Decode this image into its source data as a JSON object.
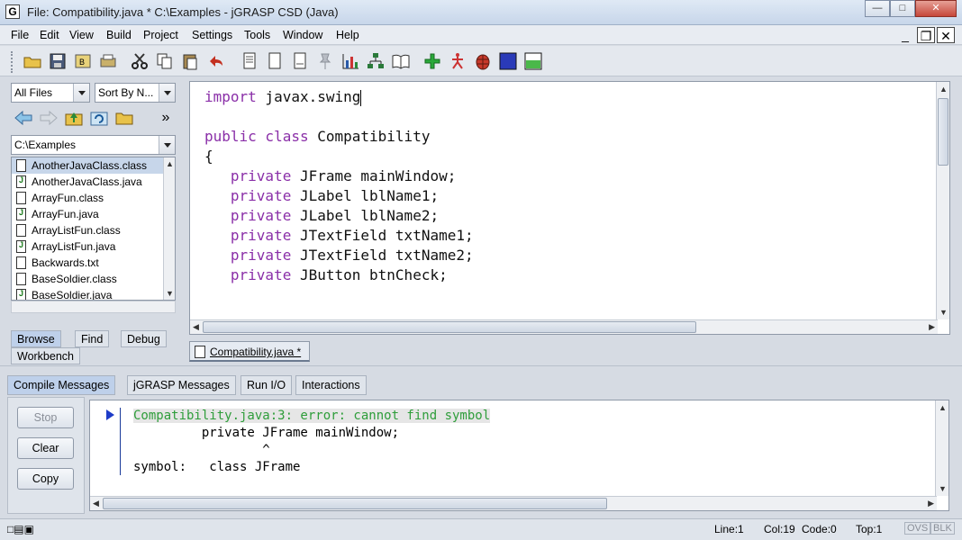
{
  "window": {
    "title": "File: Compatibility.java *  C:\\Examples - jGRASP CSD (Java)",
    "app_icon": "G",
    "controls": [
      "minimize",
      "maximize",
      "close"
    ]
  },
  "menu": [
    "File",
    "Edit",
    "View",
    "Build",
    "Project",
    "Settings",
    "Tools",
    "Window",
    "Help"
  ],
  "toolbar": {
    "icons": [
      "open-folder-icon",
      "save-icon",
      "save-all-icon",
      "print-icon",
      "cut-icon",
      "copy-icon",
      "paste-icon",
      "undo-icon",
      "document-icon",
      "document-icon-2",
      "document-icon-3",
      "pin-icon",
      "chart-icon",
      "tree-icon",
      "book-icon",
      "compile-icon",
      "run-icon",
      "debug-icon",
      "square-icon",
      "panel-icon"
    ]
  },
  "browse": {
    "filter": "All Files",
    "sort": "Sort By N...",
    "path": "C:\\Examples",
    "files": [
      {
        "name": "AnotherJavaClass.class",
        "type": "class",
        "selected": true
      },
      {
        "name": "AnotherJavaClass.java",
        "type": "java"
      },
      {
        "name": "ArrayFun.class",
        "type": "class"
      },
      {
        "name": "ArrayFun.java",
        "type": "java"
      },
      {
        "name": "ArrayListFun.class",
        "type": "class"
      },
      {
        "name": "ArrayListFun.java",
        "type": "java"
      },
      {
        "name": "Backwards.txt",
        "type": "text"
      },
      {
        "name": "BaseSoldier.class",
        "type": "class"
      },
      {
        "name": "BaseSoldier.java",
        "type": "java"
      }
    ],
    "tabs": [
      "Browse",
      "Find",
      "Debug",
      "Workbench"
    ],
    "nav_more": "»"
  },
  "editor": {
    "tab": "Compatibility.java *",
    "lines": [
      {
        "kw": "import",
        "rest": " javax.swing"
      },
      {
        "kw": "",
        "rest": ""
      },
      {
        "kw": "public class",
        "rest": " Compatibility"
      },
      {
        "kw": "",
        "rest": "{"
      },
      {
        "kw": "   private",
        "rest": " JFrame mainWindow;"
      },
      {
        "kw": "   private",
        "rest": " JLabel lblName1;"
      },
      {
        "kw": "   private",
        "rest": " JLabel lblName2;"
      },
      {
        "kw": "   private",
        "rest": " JTextField txtName1;"
      },
      {
        "kw": "   private",
        "rest": " JTextField txtName2;"
      },
      {
        "kw": "   private",
        "rest": " JButton btnCheck;"
      }
    ]
  },
  "messages": {
    "tabs": [
      "Compile Messages",
      "jGRASP Messages",
      "Run I/O",
      "Interactions"
    ],
    "buttons": [
      "Stop",
      "Clear",
      "Copy"
    ],
    "error": "Compatibility.java:3: error: cannot find symbol",
    "lines": [
      "         private JFrame mainWindow;",
      "                 ^",
      "symbol:   class JFrame"
    ]
  },
  "status": {
    "line": "Line:1",
    "col": "Col:19",
    "code": "Code:0",
    "top": "Top:1",
    "ovs": "OVS",
    "blk": "BLK"
  }
}
